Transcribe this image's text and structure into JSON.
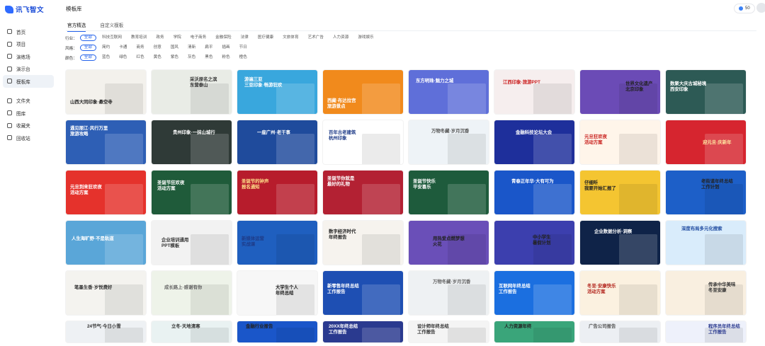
{
  "brand": {
    "name": "讯飞智文"
  },
  "sidebar": {
    "items": [
      {
        "label": "首页"
      },
      {
        "label": "项目"
      },
      {
        "label": "演练场"
      },
      {
        "label": "演示台"
      },
      {
        "label": "模板库"
      },
      {
        "label": "文件夹"
      },
      {
        "label": "图库"
      },
      {
        "label": "收藏夹"
      },
      {
        "label": "回收站"
      }
    ]
  },
  "header": {
    "title": "模板库",
    "credit": "50"
  },
  "tabs": [
    {
      "label": "官方精选"
    },
    {
      "label": "自定义模板"
    }
  ],
  "filters": {
    "industry": {
      "label": "行业：",
      "options": [
        "全部",
        "科技互联网",
        "教育培训",
        "政务",
        "学院",
        "电子商务",
        "金融保险",
        "法律",
        "医疗健康",
        "文旅体育",
        "艺术广告",
        "人力资源",
        "游戏娱乐"
      ]
    },
    "style": {
      "label": "风格：",
      "options": [
        "全部",
        "简约",
        "卡通",
        "商务",
        "创意",
        "国风",
        "清新",
        "扁平",
        "插画",
        "节日"
      ]
    },
    "color": {
      "label": "颜色：",
      "options": [
        "全部",
        "蓝色",
        "绿色",
        "红色",
        "黄色",
        "紫色",
        "灰色",
        "黑色",
        "粉色",
        "橙色"
      ]
    }
  },
  "templates": [
    {
      "title": "山西大同印象·悬空寺",
      "bg": "#f3f1ec",
      "fg": "#222"
    },
    {
      "title": "采沃原名之滨\n东营泰山",
      "bg": "#e9ece6",
      "fg": "#333"
    },
    {
      "title": "游遍三亚\n三亚印象·畅游狂欢",
      "bg": "#39a7dd",
      "fg": "#fff"
    },
    {
      "title": "西藏·布达拉宫\n旅游景点",
      "bg": "#f18a1c",
      "fg": "#fff"
    },
    {
      "title": "东方明珠·魅力之城",
      "bg": "#5f6fd9",
      "fg": "#fff"
    },
    {
      "title": "江西印象·旅游PPT",
      "bg": "#f6eeee",
      "fg": "#c22"
    },
    {
      "title": "世界文化遗产\n北京印象",
      "bg": "#6b4bb6",
      "fg": "#222"
    },
    {
      "title": "数聚大庆古城秘境\n西安印象",
      "bg": "#2d5a55",
      "fg": "#fff"
    },
    {
      "title": "遇见丽江·风行万里\n旅游攻略",
      "bg": "#2e5fb5",
      "fg": "#fff"
    },
    {
      "title": "贵州印象·一抹山城行",
      "bg": "#2f3a37",
      "fg": "#fff"
    },
    {
      "title": "一座广州·老干事",
      "bg": "#1f4b9c",
      "fg": "#fff"
    },
    {
      "title": "百年古老建筑\n杭州印象",
      "bg": "#fff",
      "fg": "#1f3c88"
    },
    {
      "title": "万物冬藏·岁月沉香",
      "bg": "#eef3f7",
      "fg": "#555"
    },
    {
      "title": "金融科技论坛大会",
      "bg": "#1e2f9b",
      "fg": "#fff"
    },
    {
      "title": "元旦狂欢夜\n活动方案",
      "bg": "#fff5ea",
      "fg": "#c9211e"
    },
    {
      "title": "迎元旦·庆新年",
      "bg": "#d6252f",
      "fg": "#ffe7a1"
    },
    {
      "title": "元旦到来狂欢夜\n活动方案",
      "bg": "#e5322c",
      "fg": "#fff"
    },
    {
      "title": "圣诞节狂欢夜\n活动方案",
      "bg": "#1f5b3a",
      "fg": "#fff"
    },
    {
      "title": "圣诞节的钟声\n报名通知",
      "bg": "#b71c2c",
      "fg": "#ffe08a"
    },
    {
      "title": "圣诞节你就是\n最好的礼物",
      "bg": "#b32133",
      "fg": "#fff"
    },
    {
      "title": "圣诞节快乐\n平安喜乐",
      "bg": "#1e5b3c",
      "fg": "#fff"
    },
    {
      "title": "青春正年华·大有可为",
      "bg": "#1a56c9",
      "fg": "#fff"
    },
    {
      "title": "仔细听\n我要开始汇报了",
      "bg": "#f4c531",
      "fg": "#222"
    },
    {
      "title": "老街道年终总结\n工作计划",
      "bg": "#1d5fc8",
      "fg": "#222"
    },
    {
      "title": "人生海旷野·不是轨道",
      "bg": "#5aa6d8",
      "fg": "#fff"
    },
    {
      "title": "企业培训通用\nPPT模板",
      "bg": "#f2f2f2",
      "fg": "#333"
    },
    {
      "title": "新媒体运营\n实战课",
      "bg": "#1f5fbf",
      "fg": "#1f3c88"
    },
    {
      "title": "数字经济时代\n年终报告",
      "bg": "#f6f3ee",
      "fg": "#222"
    },
    {
      "title": "用热爱点燃梦想\n火花",
      "bg": "#6a4fb8",
      "fg": "#222"
    },
    {
      "title": "中小学生\n暑假计划",
      "bg": "#3c3fae",
      "fg": "#222"
    },
    {
      "title": "企业数据分析·洞察",
      "bg": "#0f2348",
      "fg": "#fff"
    },
    {
      "title": "深度布局多元化搜索",
      "bg": "#d9ecfb",
      "fg": "#1f4ba0"
    },
    {
      "title": "笔墨生香·岁悦费好",
      "bg": "#f4f3ef",
      "fg": "#333"
    },
    {
      "title": "成长路上·感谢有你",
      "bg": "#eef3e9",
      "fg": "#666"
    },
    {
      "title": "大学生个人\n年终总结",
      "bg": "#f7f7f7",
      "fg": "#222"
    },
    {
      "title": "新零售年终总结\n工作报告",
      "bg": "#1e4fb3",
      "fg": "#fff"
    },
    {
      "title": "万物冬藏·岁月沉香",
      "bg": "#eef1f3",
      "fg": "#666"
    },
    {
      "title": "互联网年终总结\n工作报告",
      "bg": "#1b6fe0",
      "fg": "#fff"
    },
    {
      "title": "冬至·安康快乐\n活动方案",
      "bg": "#fbf1e0",
      "fg": "#b3261e"
    },
    {
      "title": "传承中华美味\n冬至安康",
      "bg": "#f9efe0",
      "fg": "#333"
    },
    {
      "title": "24节气·今日小雪",
      "bg": "#eef1f4",
      "fg": "#333"
    },
    {
      "title": "立冬·天地清寒",
      "bg": "#e9f2f2",
      "fg": "#333"
    },
    {
      "title": "金融行业报告",
      "bg": "#1a56c9",
      "fg": "#222"
    },
    {
      "title": "20XX年终总结\n工作报告",
      "bg": "#2a3a8f",
      "fg": "#fff"
    },
    {
      "title": "设计师年终总结\n工作报告",
      "bg": "#f4f4f4",
      "fg": "#333"
    },
    {
      "title": "人力资源年终",
      "bg": "#3aa57a",
      "fg": "#222"
    },
    {
      "title": "广告公司报告",
      "bg": "#eceff3",
      "fg": "#555"
    },
    {
      "title": "程序员年终总结\n工作报告",
      "bg": "#eef1fb",
      "fg": "#2a3a8f"
    }
  ],
  "colors": {
    "accent": "#2563eb",
    "brand": "#1d4ed8"
  }
}
